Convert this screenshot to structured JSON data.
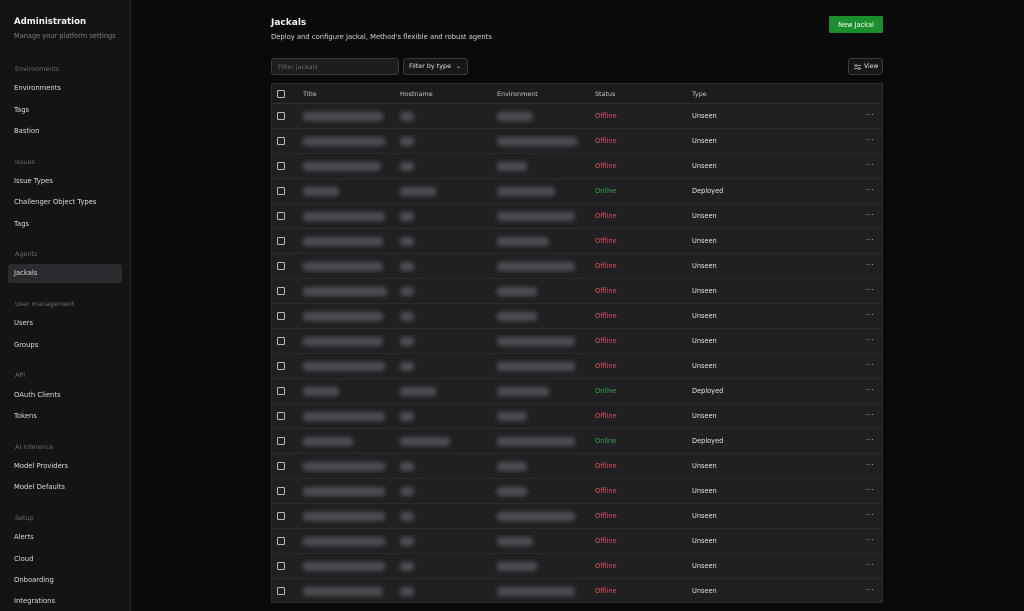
{
  "sidebar": {
    "title": "Administration",
    "subtitle": "Manage your platform settings",
    "sections": [
      {
        "label": "Environments",
        "items": [
          "Environments",
          "Tags",
          "Bastion"
        ]
      },
      {
        "label": "Issues",
        "items": [
          "Issue Types",
          "Challenger Object Types",
          "Tags"
        ]
      },
      {
        "label": "Agents",
        "items": [
          "Jackals"
        ]
      },
      {
        "label": "User management",
        "items": [
          "Users",
          "Groups"
        ]
      },
      {
        "label": "API",
        "items": [
          "OAuth Clients",
          "Tokens"
        ]
      },
      {
        "label": "AI Inference",
        "items": [
          "Model Providers",
          "Model Defaults"
        ]
      },
      {
        "label": "Setup",
        "items": [
          "Alerts",
          "Cloud",
          "Onboarding",
          "Integrations"
        ]
      }
    ],
    "active_item": "Jackals"
  },
  "header": {
    "title": "Jackals",
    "description": "Deploy and configure Jackal, Method's flexible and robust agents",
    "new_button": "New Jackal"
  },
  "toolbar": {
    "filter_placeholder": "Filter jackals",
    "filter_value": "",
    "filter_type_label": "Filter by type",
    "view_label": "View"
  },
  "table": {
    "columns": [
      "Title",
      "Hostname",
      "Environment",
      "Status",
      "Type"
    ],
    "rows": [
      {
        "status": "Offline",
        "type": "Unseen"
      },
      {
        "status": "Offline",
        "type": "Unseen"
      },
      {
        "status": "Offline",
        "type": "Unseen"
      },
      {
        "status": "Online",
        "type": "Deployed"
      },
      {
        "status": "Offline",
        "type": "Unseen"
      },
      {
        "status": "Offline",
        "type": "Unseen"
      },
      {
        "status": "Offline",
        "type": "Unseen"
      },
      {
        "status": "Offline",
        "type": "Unseen"
      },
      {
        "status": "Offline",
        "type": "Unseen"
      },
      {
        "status": "Offline",
        "type": "Unseen"
      },
      {
        "status": "Offline",
        "type": "Unseen"
      },
      {
        "status": "Online",
        "type": "Deployed"
      },
      {
        "status": "Offline",
        "type": "Unseen"
      },
      {
        "status": "Online",
        "type": "Deployed"
      },
      {
        "status": "Offline",
        "type": "Unseen"
      },
      {
        "status": "Offline",
        "type": "Unseen"
      },
      {
        "status": "Offline",
        "type": "Unseen"
      },
      {
        "status": "Offline",
        "type": "Unseen"
      },
      {
        "status": "Offline",
        "type": "Unseen"
      },
      {
        "status": "Offline",
        "type": "Unseen"
      }
    ],
    "row_action_glyph": "···"
  },
  "colors": {
    "accent_green": "#198f2b",
    "status_offline": "#e04f5b",
    "status_online": "#35a64d"
  }
}
